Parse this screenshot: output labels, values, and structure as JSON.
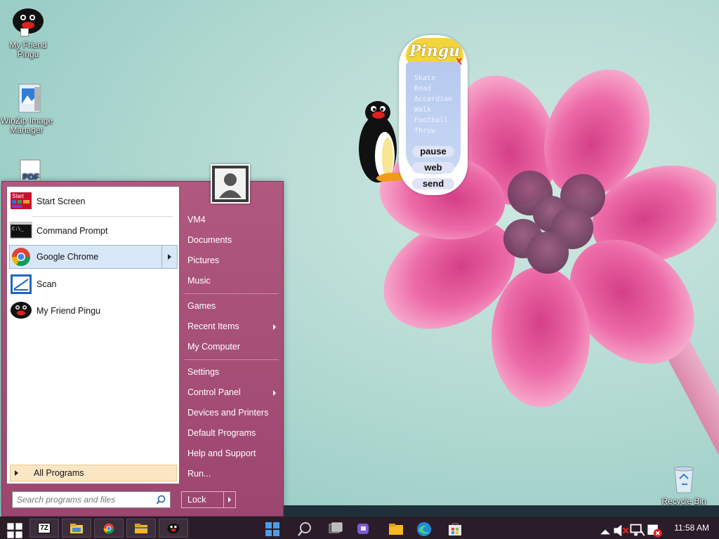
{
  "desktop": {
    "icons": [
      {
        "label": "My Friend Pingu"
      },
      {
        "label": "WinZip Image Manager"
      },
      {
        "label": "PDF"
      },
      {
        "label": "Recycle Bin"
      }
    ]
  },
  "pingu_widget": {
    "logo": "Pingu",
    "close": "X",
    "actions": [
      "Skate",
      "Read",
      "Accordian",
      "Walk",
      "Football",
      "Throw"
    ],
    "buttons": {
      "pause": "pause",
      "web": "web",
      "send": "send"
    }
  },
  "start_menu": {
    "programs": [
      {
        "label": "Start Screen",
        "icon": "start-screen-icon"
      },
      {
        "label": "Command Prompt",
        "icon": "command-prompt-icon"
      },
      {
        "label": "Google Chrome",
        "icon": "chrome-icon"
      },
      {
        "label": "Scan",
        "icon": "scan-icon"
      },
      {
        "label": "My Friend Pingu",
        "icon": "pingu-icon"
      }
    ],
    "start_icon_text": "Start",
    "cmd_icon_text": "C:\\_",
    "all_programs": "All Programs",
    "search_placeholder": "Search programs and files",
    "right": {
      "user": "VM4",
      "documents": "Documents",
      "pictures": "Pictures",
      "music": "Music",
      "games": "Games",
      "recent": "Recent Items",
      "computer": "My Computer",
      "settings": "Settings",
      "control_panel": "Control Panel",
      "devices": "Devices and Printers",
      "defaults": "Default Programs",
      "help": "Help and Support",
      "run": "Run..."
    },
    "lock": "Lock"
  },
  "taskbar": {
    "clock": "11:58 AM",
    "zip_label": "7Z"
  },
  "colors": {
    "start_menu": "#a44f77",
    "taskbar": "#2b1c2a",
    "selected_item": "#d7e7f7",
    "all_programs_bg": "#fbe6c4"
  }
}
